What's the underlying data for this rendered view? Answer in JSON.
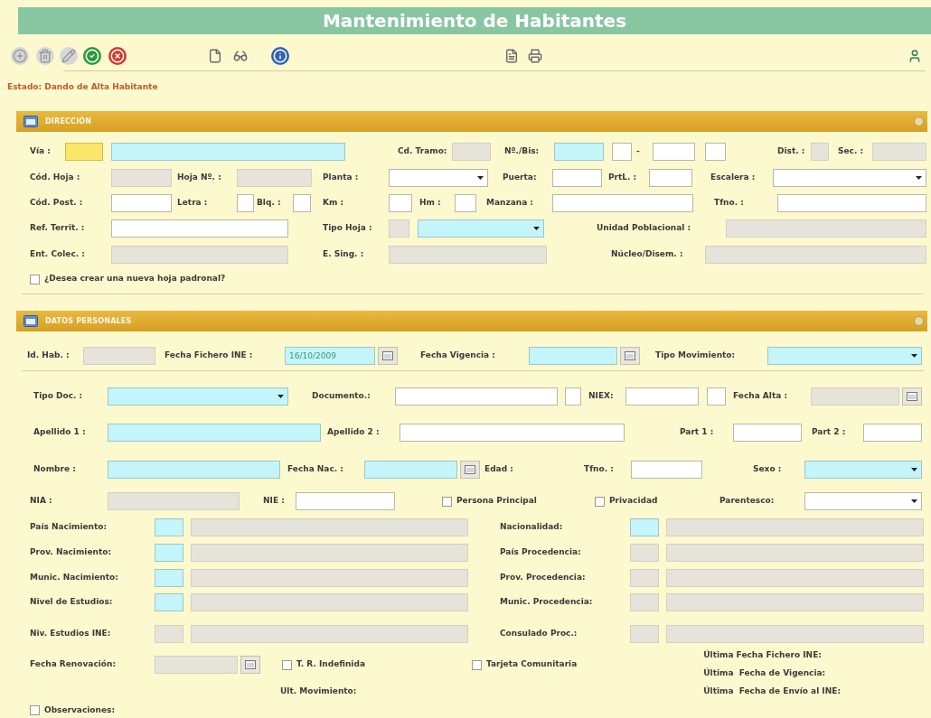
{
  "title": "Mantenimiento de Habitantes",
  "toolbar": [
    {
      "kind": "add",
      "disabled": true
    },
    {
      "kind": "delete",
      "disabled": true
    },
    {
      "kind": "edit",
      "disabled": true
    },
    {
      "kind": "accept",
      "disabled": false
    },
    {
      "kind": "cancel",
      "disabled": false
    },
    {
      "kind": "new",
      "disabled": false
    },
    {
      "kind": "view",
      "disabled": false
    },
    {
      "kind": "info",
      "disabled": false
    },
    {
      "kind": "report",
      "disabled": false
    },
    {
      "kind": "print",
      "disabled": false
    },
    {
      "kind": "exit",
      "disabled": false
    }
  ],
  "status": "Estado: Dando de Alta Habitante",
  "sections": [
    {
      "title": "DIRECCIÓN",
      "rows": [
        {
          "items": [
            {
              "kind": "label",
              "text": "Vía :"
            },
            {
              "kind": "input",
              "focused": true,
              "required": false,
              "disabled": false
            },
            {
              "kind": "input",
              "focused": false,
              "required": true,
              "disabled": false
            },
            {
              "kind": "label",
              "text": "Cd. Tramo:"
            },
            {
              "kind": "input",
              "focused": false,
              "required": false,
              "disabled": true
            },
            {
              "kind": "label",
              "text": "Nº./Bis:"
            },
            {
              "kind": "input",
              "focused": false,
              "required": true,
              "disabled": false
            },
            {
              "kind": "input",
              "focused": false,
              "required": false,
              "disabled": false
            },
            {
              "kind": "label",
              "text": "-"
            },
            {
              "kind": "input",
              "focused": false,
              "required": false,
              "disabled": false
            },
            {
              "kind": "input",
              "focused": false,
              "required": false,
              "disabled": false
            },
            {
              "kind": "label",
              "text": "Dist. :"
            },
            {
              "kind": "input",
              "focused": false,
              "required": false,
              "disabled": true
            },
            {
              "kind": "label",
              "text": "Sec. :"
            },
            {
              "kind": "input",
              "focused": false,
              "required": false,
              "disabled": true
            }
          ]
        },
        {
          "items": [
            {
              "kind": "label",
              "text": "Cód. Hoja :"
            },
            {
              "kind": "input",
              "focused": false,
              "required": false,
              "disabled": true
            },
            {
              "kind": "label",
              "text": "Hoja Nº. :"
            },
            {
              "kind": "input",
              "focused": false,
              "required": false,
              "disabled": true
            },
            {
              "kind": "label",
              "text": "Planta :"
            },
            {
              "kind": "select",
              "focused": false,
              "required": false,
              "disabled": false
            },
            {
              "kind": "label",
              "text": "Puerta:"
            },
            {
              "kind": "input",
              "focused": false,
              "required": false,
              "disabled": false
            },
            {
              "kind": "label",
              "text": "PrtL. :"
            },
            {
              "kind": "input",
              "focused": false,
              "required": false,
              "disabled": false
            },
            {
              "kind": "label",
              "text": "Escalera :"
            },
            {
              "kind": "select",
              "focused": false,
              "required": false,
              "disabled": false
            }
          ]
        },
        {
          "items": [
            {
              "kind": "label",
              "text": "Cód. Post. :"
            },
            {
              "kind": "input",
              "focused": false,
              "required": false,
              "disabled": false
            },
            {
              "kind": "label",
              "text": "Letra :"
            },
            {
              "kind": "input",
              "focused": false,
              "required": false,
              "disabled": false
            },
            {
              "kind": "label",
              "text": "Blq. :"
            },
            {
              "kind": "input",
              "focused": false,
              "required": false,
              "disabled": false
            },
            {
              "kind": "label",
              "text": "Km :"
            },
            {
              "kind": "input",
              "focused": false,
              "required": false,
              "disabled": false
            },
            {
              "kind": "label",
              "text": "Hm :"
            },
            {
              "kind": "input",
              "focused": false,
              "required": false,
              "disabled": false
            },
            {
              "kind": "label",
              "text": "Manzana :"
            },
            {
              "kind": "input",
              "focused": false,
              "required": false,
              "disabled": false
            },
            {
              "kind": "label",
              "text": "Tfno. :"
            },
            {
              "kind": "input",
              "focused": false,
              "required": false,
              "disabled": false
            }
          ]
        },
        {
          "items": [
            {
              "kind": "label",
              "text": "Ref. Territ. :"
            },
            {
              "kind": "input",
              "focused": false,
              "required": false,
              "disabled": false
            },
            {
              "kind": "label",
              "text": "Tipo Hoja :"
            },
            {
              "kind": "input",
              "focused": false,
              "required": false,
              "disabled": true
            },
            {
              "kind": "select",
              "focused": false,
              "required": true,
              "disabled": false
            },
            {
              "kind": "label",
              "text": "Unidad Poblacional :"
            },
            {
              "kind": "input",
              "focused": false,
              "required": false,
              "disabled": true
            }
          ]
        },
        {
          "items": [
            {
              "kind": "label",
              "text": "Ent. Colec. :"
            },
            {
              "kind": "input",
              "focused": false,
              "required": false,
              "disabled": true
            },
            {
              "kind": "label",
              "text": "E. Sing. :"
            },
            {
              "kind": "input",
              "focused": false,
              "required": false,
              "disabled": true
            },
            {
              "kind": "label",
              "text": "Núcleo/Disem. :"
            },
            {
              "kind": "input",
              "focused": false,
              "required": false,
              "disabled": true
            }
          ]
        },
        {
          "items": [
            {
              "kind": "checkbox",
              "label": "¿Desea crear una nueva hoja padronal?",
              "checked": false
            }
          ]
        }
      ]
    },
    {
      "title": "DATOS PERSONALES",
      "rows": [
        {
          "items": [
            {
              "kind": "label",
              "text": "Id. Hab. :"
            },
            {
              "kind": "input",
              "focused": false,
              "required": false,
              "disabled": true
            },
            {
              "kind": "label",
              "text": "Fecha Fichero INE :"
            },
            {
              "kind": "date",
              "focused": false,
              "required": true,
              "disabled": false,
              "value": "16/10/2009"
            },
            {
              "kind": "label",
              "text": "Fecha Vigencia :"
            },
            {
              "kind": "date",
              "focused": false,
              "required": true,
              "disabled": false
            },
            {
              "kind": "label",
              "text": "Tipo Movimiento:"
            },
            {
              "kind": "select",
              "focused": false,
              "required": true,
              "disabled": false
            }
          ]
        },
        {
          "items": [
            {
              "kind": "label",
              "text": "Tipo Doc. :"
            },
            {
              "kind": "select",
              "focused": false,
              "required": true,
              "disabled": false
            },
            {
              "kind": "label",
              "text": "Documento.:"
            },
            {
              "kind": "input",
              "focused": false,
              "required": false,
              "disabled": false
            },
            {
              "kind": "input",
              "focused": false,
              "required": false,
              "disabled": false
            },
            {
              "kind": "label",
              "text": "NIEX:"
            },
            {
              "kind": "input",
              "focused": false,
              "required": false,
              "disabled": false
            },
            {
              "kind": "input",
              "focused": false,
              "required": false,
              "disabled": false
            },
            {
              "kind": "label",
              "text": "Fecha Alta :"
            },
            {
              "kind": "date",
              "focused": false,
              "required": false,
              "disabled": true
            }
          ]
        },
        {
          "items": [
            {
              "kind": "label",
              "text": "Apellido 1 :"
            },
            {
              "kind": "input",
              "focused": false,
              "required": true,
              "disabled": false
            },
            {
              "kind": "label",
              "text": "Apellido 2 :"
            },
            {
              "kind": "input",
              "focused": false,
              "required": false,
              "disabled": false
            },
            {
              "kind": "label",
              "text": "Part 1 :"
            },
            {
              "kind": "input",
              "focused": false,
              "required": false,
              "disabled": false
            },
            {
              "kind": "label",
              "text": "Part 2 :"
            },
            {
              "kind": "input",
              "focused": false,
              "required": false,
              "disabled": false
            }
          ]
        },
        {
          "items": [
            {
              "kind": "label",
              "text": "Nombre :"
            },
            {
              "kind": "input",
              "focused": false,
              "required": true,
              "disabled": false
            },
            {
              "kind": "label",
              "text": "Fecha Nac. :"
            },
            {
              "kind": "date",
              "focused": false,
              "required": true,
              "disabled": false
            },
            {
              "kind": "label",
              "text": "Edad :"
            },
            {
              "kind": "label",
              "text": "Tfno. :"
            },
            {
              "kind": "input",
              "focused": false,
              "required": false,
              "disabled": false
            },
            {
              "kind": "label",
              "text": "Sexo :"
            },
            {
              "kind": "select",
              "focused": false,
              "required": true,
              "disabled": false
            }
          ]
        },
        {
          "items": [
            {
              "kind": "label",
              "text": "NIA :"
            },
            {
              "kind": "input",
              "focused": false,
              "required": false,
              "disabled": true
            },
            {
              "kind": "label",
              "text": "NIE :"
            },
            {
              "kind": "input",
              "focused": false,
              "required": false,
              "disabled": false
            },
            {
              "kind": "checkbox",
              "label": "Persona Principal",
              "checked": false
            },
            {
              "kind": "checkbox",
              "label": "Privacidad",
              "checked": false
            },
            {
              "kind": "label",
              "text": "Parentesco:"
            },
            {
              "kind": "select",
              "focused": false,
              "required": false,
              "disabled": false
            }
          ]
        },
        {
          "items": [
            {
              "kind": "label",
              "text": "País Nacimiento:"
            },
            {
              "kind": "input",
              "focused": false,
              "required": true,
              "disabled": false
            },
            {
              "kind": "input",
              "focused": false,
              "required": false,
              "disabled": true
            },
            {
              "kind": "label",
              "text": "Nacionalidad:"
            },
            {
              "kind": "input",
              "focused": false,
              "required": true,
              "disabled": false
            },
            {
              "kind": "input",
              "focused": false,
              "required": false,
              "disabled": true
            }
          ]
        },
        {
          "items": [
            {
              "kind": "label",
              "text": "Prov. Nacimiento:"
            },
            {
              "kind": "input",
              "focused": false,
              "required": true,
              "disabled": false
            },
            {
              "kind": "input",
              "focused": false,
              "required": false,
              "disabled": true
            },
            {
              "kind": "label",
              "text": "País Procedencia:"
            },
            {
              "kind": "input",
              "focused": false,
              "required": false,
              "disabled": true
            },
            {
              "kind": "input",
              "focused": false,
              "required": false,
              "disabled": true
            }
          ]
        },
        {
          "items": [
            {
              "kind": "label",
              "text": "Munic. Nacimiento:"
            },
            {
              "kind": "input",
              "focused": false,
              "required": true,
              "disabled": false
            },
            {
              "kind": "input",
              "focused": false,
              "required": false,
              "disabled": true
            },
            {
              "kind": "label",
              "text": "Prov. Procedencia:"
            },
            {
              "kind": "input",
              "focused": false,
              "required": false,
              "disabled": true
            },
            {
              "kind": "input",
              "focused": false,
              "required": false,
              "disabled": true
            }
          ]
        },
        {
          "items": [
            {
              "kind": "label",
              "text": "Nivel de Estudios:"
            },
            {
              "kind": "input",
              "focused": false,
              "required": true,
              "disabled": false
            },
            {
              "kind": "input",
              "focused": false,
              "required": false,
              "disabled": true
            },
            {
              "kind": "label",
              "text": "Munic. Procedencia:"
            },
            {
              "kind": "input",
              "focused": false,
              "required": false,
              "disabled": true
            },
            {
              "kind": "input",
              "focused": false,
              "required": false,
              "disabled": true
            }
          ]
        },
        {
          "items": [
            {
              "kind": "label",
              "text": "Niv. Estudios INE:"
            },
            {
              "kind": "input",
              "focused": false,
              "required": false,
              "disabled": true
            },
            {
              "kind": "input",
              "focused": false,
              "required": false,
              "disabled": true
            },
            {
              "kind": "label",
              "text": "Consulado Proc.:"
            },
            {
              "kind": "input",
              "focused": false,
              "required": false,
              "disabled": true
            },
            {
              "kind": "input",
              "focused": false,
              "required": false,
              "disabled": true
            }
          ]
        }
      ],
      "footer": {
        "renewal": {
          "kind": "date",
          "label": "Fecha Renovación:",
          "focused": false,
          "required": false,
          "disabled": true
        },
        "checkboxes": [
          {
            "label": "T. R. Indefinida",
            "checked": false
          },
          {
            "label": "Tarjeta Comunitaria",
            "checked": false
          }
        ],
        "last_movement": "Ult. Movimiento:",
        "last_dates": [
          "Última Fecha Fichero INE:",
          "Última  Fecha de Vigencia:",
          "Última  Fecha de Envío al INE:"
        ],
        "observations": {
          "label": "Observaciones:",
          "checked": false
        }
      }
    }
  ]
}
